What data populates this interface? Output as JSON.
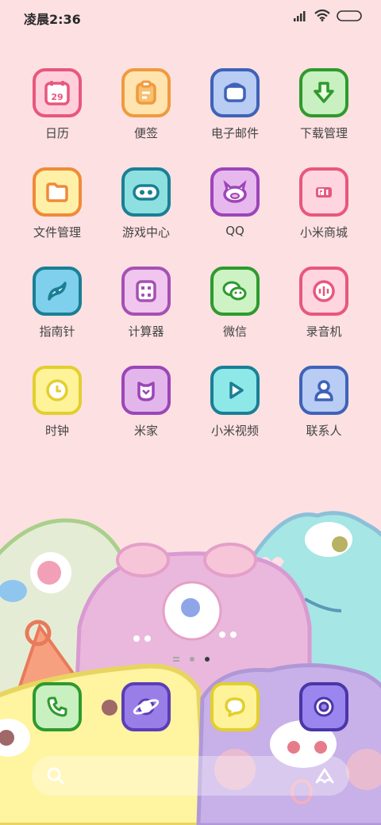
{
  "status_bar": {
    "time": "凌晨2:36"
  },
  "apps": [
    {
      "label": "日历",
      "icon": "calendar-icon",
      "bg": "#ffd0dc",
      "border": "#e8577c",
      "badge": "29"
    },
    {
      "label": "便签",
      "icon": "notes-icon",
      "bg": "#ffe4b0",
      "border": "#f09a3e"
    },
    {
      "label": "电子邮件",
      "icon": "email-icon",
      "bg": "#b8ccf4",
      "border": "#3f62b8"
    },
    {
      "label": "下载管理",
      "icon": "download-icon",
      "bg": "#c8f0c0",
      "border": "#2e9a2e"
    },
    {
      "label": "文件管理",
      "icon": "folder-icon",
      "bg": "#fff0a8",
      "border": "#f08a38"
    },
    {
      "label": "游戏中心",
      "icon": "gamepad-icon",
      "bg": "#8ee0e0",
      "border": "#1a7f95"
    },
    {
      "label": "QQ",
      "icon": "qq-icon",
      "bg": "#e6b8ee",
      "border": "#9c45b8"
    },
    {
      "label": "小米商城",
      "icon": "mi-store-icon",
      "bg": "#ffd6e0",
      "border": "#e8577c"
    },
    {
      "label": "指南针",
      "icon": "compass-icon",
      "bg": "#7fd0ec",
      "border": "#1a7f95"
    },
    {
      "label": "计算器",
      "icon": "calculator-icon",
      "bg": "#f0c6ee",
      "border": "#a650b4"
    },
    {
      "label": "微信",
      "icon": "wechat-icon",
      "bg": "#cdf3c5",
      "border": "#2e9a2e"
    },
    {
      "label": "录音机",
      "icon": "recorder-icon",
      "bg": "#ffd6e0",
      "border": "#e8577c"
    },
    {
      "label": "时钟",
      "icon": "clock-icon",
      "bg": "#fff39a",
      "border": "#e2cf2e"
    },
    {
      "label": "米家",
      "icon": "mijia-icon",
      "bg": "#e2b6ea",
      "border": "#9c45b8"
    },
    {
      "label": "小米视频",
      "icon": "video-icon",
      "bg": "#8ee8e8",
      "border": "#1a7f95"
    },
    {
      "label": "联系人",
      "icon": "contacts-icon",
      "bg": "#b8ccf4",
      "border": "#3f62b8"
    }
  ],
  "dock": [
    {
      "icon": "phone-icon",
      "bg": "#c8f0c0",
      "border": "#2e9a2e"
    },
    {
      "icon": "browser-icon",
      "bg": "#9a7ee8",
      "border": "#5a3eb8"
    },
    {
      "icon": "messages-icon",
      "bg": "#fff39a",
      "border": "#e2cf2e"
    },
    {
      "icon": "camera-icon",
      "bg": "#9a86ee",
      "border": "#4a36a8"
    }
  ],
  "page_indicator": {
    "pages": 3,
    "active": 3
  }
}
